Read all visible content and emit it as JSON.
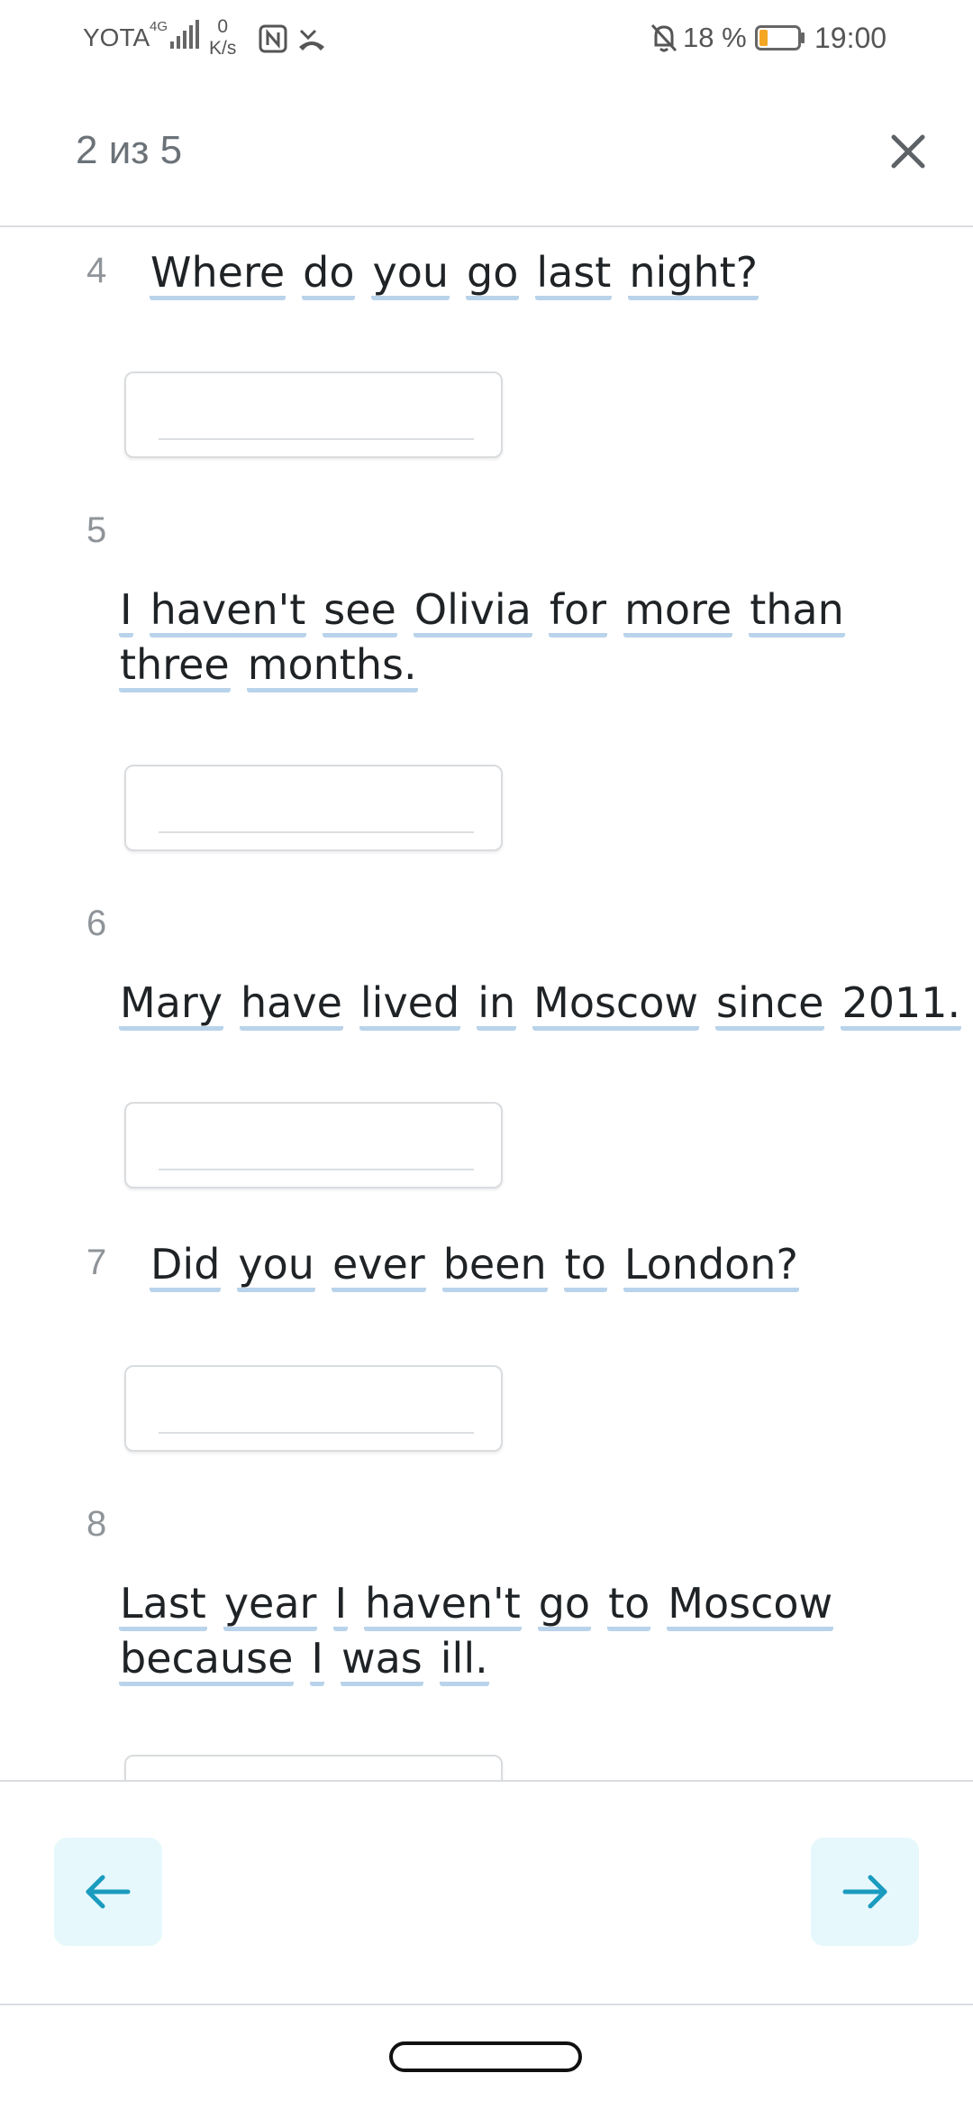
{
  "status_bar": {
    "carrier": "YOTA",
    "network": "4G",
    "speed_value": "0",
    "speed_unit": "K/s",
    "battery_percent": "18 %",
    "time": "19:00"
  },
  "header": {
    "progress": "2 из 5"
  },
  "questions": [
    {
      "number": "4",
      "words": [
        "Where",
        "do",
        "you",
        "go",
        "last",
        "night?"
      ]
    },
    {
      "number": "5",
      "line1": [
        "I",
        "haven't",
        "see",
        "Olivia",
        "for",
        "more",
        "than"
      ],
      "line2": [
        "three",
        "months."
      ]
    },
    {
      "number": "6",
      "words": [
        "Mary",
        "have",
        "lived",
        "in",
        "Moscow",
        "since",
        "2011."
      ]
    },
    {
      "number": "7",
      "words": [
        "Did",
        "you",
        "ever",
        "been",
        "to",
        "London?"
      ]
    },
    {
      "number": "8",
      "line1": [
        "Last",
        "year",
        "I",
        "haven't",
        "go",
        "to",
        "Moscow"
      ],
      "line2": [
        "because",
        "I",
        "was",
        "ill."
      ]
    }
  ],
  "colors": {
    "accent": "#1a9bbf",
    "nav_bg": "#e6f8fc",
    "word_underline": "#b9d3eb",
    "battery_low": "#f5a623"
  }
}
